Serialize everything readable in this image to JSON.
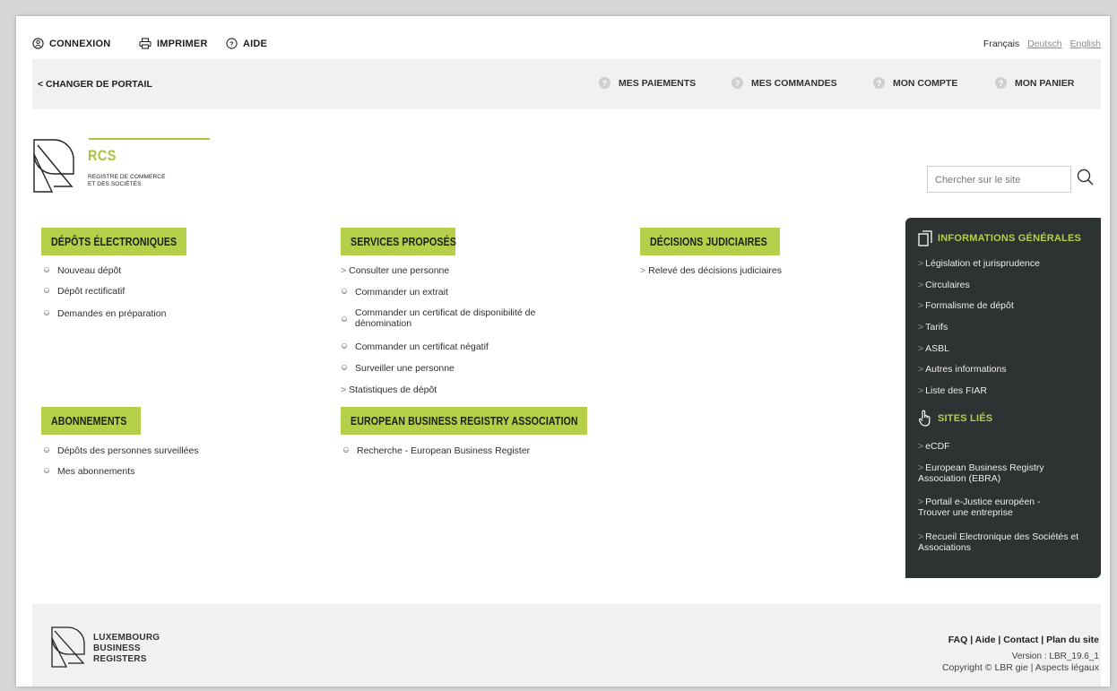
{
  "topbar": {
    "login_label": "CONNEXION",
    "print_label": "IMPRIMER",
    "help_label": "AIDE",
    "lang_fr": "Français",
    "lang_de": "Deutsch",
    "lang_en": "English"
  },
  "portal_nav": {
    "change_portal": "< CHANGER DE PORTAIL",
    "items": [
      {
        "label": "MES PAIEMENTS"
      },
      {
        "label": "MES COMMANDES"
      },
      {
        "label": "MON COMPTE"
      },
      {
        "label": "MON PANIER"
      }
    ]
  },
  "logo": {
    "title": "RCS",
    "sub1": "REGISTRE DE COMMERCE",
    "sub2": "ET DES SOCIÉTÉS"
  },
  "search": {
    "placeholder": "Chercher sur le site"
  },
  "sections": {
    "depots": {
      "title": "DÉPÔTS ÉLECTRONIQUES",
      "links": [
        "Nouveau dépôt",
        "Dépôt rectificatif",
        "Demandes en préparation"
      ]
    },
    "services": {
      "title": "SERVICES PROPOSÉS",
      "links": [
        "Consulter une personne",
        "Commander un extrait",
        "Commander un certificat de disponibilité de",
        "dénomination",
        "Commander un certificat négatif",
        "Surveiller une personne",
        "Statistiques de dépôt"
      ]
    },
    "decisions": {
      "title": "DÉCISIONS JUDICIAIRES",
      "links": [
        "Relevé des décisions judiciaires"
      ]
    },
    "abonnements": {
      "title": "ABONNEMENTS",
      "links": [
        "Dépôts des personnes surveillées",
        "Mes abonnements"
      ]
    },
    "ebra": {
      "title": "EUROPEAN BUSINESS REGISTRY ASSOCIATION",
      "links": [
        "Recherche - European Business Register"
      ]
    }
  },
  "right_panel": {
    "info_title": "INFORMATIONS GÉNÉRALES",
    "info_links": [
      "Législation et jurisprudence",
      "Circulaires",
      "Formalisme de dépôt",
      "Tarifs",
      "ASBL",
      "Autres informations",
      "Liste des FIAR"
    ],
    "sites_title": "SITES LIÉS",
    "sites_links": [
      "eCDF",
      "European Business Registry Association (EBRA)",
      "Portail e-Justice européen - Trouver une entreprise",
      "Recueil Electronique des Sociétés et Associations"
    ]
  },
  "footer": {
    "logo_line1": "LUXEMBOURG",
    "logo_line2": "BUSINESS",
    "logo_line3": "REGISTERS",
    "links": "FAQ | Aide | Contact | Plan du site",
    "version": "Version : LBR_19.6_1",
    "copyright": "Copyright © LBR gie | Aspects légaux"
  },
  "colors": {
    "accent": "#b5cf4a",
    "panel": "#2d3332",
    "nav_bg": "#f1f1f1"
  }
}
